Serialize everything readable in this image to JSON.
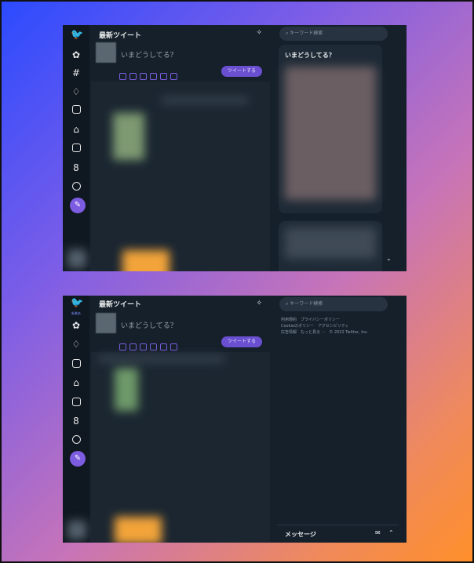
{
  "colors": {
    "accent": "#7c5ce0",
    "background": "#15202b"
  },
  "top": {
    "header": {
      "title": "最新ツイート",
      "sparkle_icon": "sparkle"
    },
    "compose": {
      "placeholder": "いまどうしてる？",
      "tweet_button": "ツイートする"
    },
    "search": {
      "placeholder": "キーワード検索"
    },
    "trends": {
      "title": "いまどうしてる？"
    },
    "nav_icons": [
      "twitter-logo",
      "home-icon",
      "hashtag-icon",
      "bell-icon",
      "mail-icon",
      "bookmark-icon",
      "list-icon",
      "profile-icon",
      "more-icon",
      "compose-icon"
    ]
  },
  "bottom": {
    "header": {
      "title": "最新ツイート",
      "logo_caption": "新着あり"
    },
    "compose": {
      "placeholder": "いまどうしてる？",
      "tweet_button": "ツイートする"
    },
    "search": {
      "placeholder": "キーワード検索"
    },
    "footer": {
      "line1": "利用規約　プライバシーポリシー",
      "line2": "Cookieのポリシー　アクセシビリティ",
      "line3": "広告情報　もっと見る ···　© 2022 Twitter, Inc."
    },
    "messages": {
      "title": "メッセージ"
    },
    "nav_icons": [
      "twitter-logo",
      "home-icon",
      "bell-icon",
      "mail-icon",
      "bookmark-icon",
      "list-icon",
      "profile-icon",
      "more-icon",
      "compose-icon"
    ]
  }
}
